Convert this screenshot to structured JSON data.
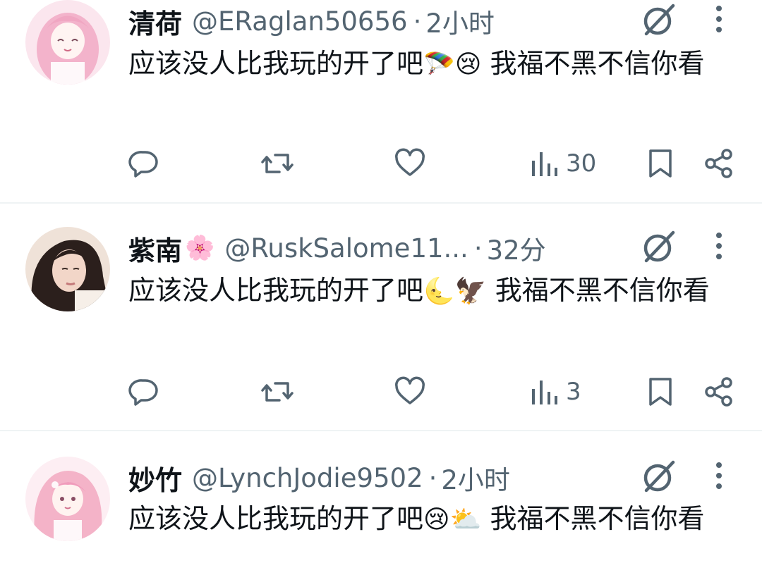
{
  "tweets": [
    {
      "name": "清荷",
      "name_emoji": "",
      "handle": "@ERaglan50656",
      "separator": "·",
      "time": "2小时",
      "text_before": "应该没人比我玩的开了吧",
      "emoji_1": "🪂",
      "emoji_2": "😢",
      "text_after": " 我福不黑不信你看",
      "views": "30",
      "avatar_colors": [
        "#f8d7e6",
        "#f2a9c7",
        "#fff1f6"
      ]
    },
    {
      "name": "紫南",
      "name_emoji": "🌸",
      "handle": "@RuskSalome11...",
      "separator": "·",
      "time": "32分",
      "text_before": "应该没人比我玩的开了吧",
      "emoji_1": "🌜",
      "emoji_2": "🦅",
      "text_after": " 我福不黑不信你看",
      "views": "3",
      "avatar_colors": [
        "#3a2a24",
        "#d9b8a8",
        "#f3e6dd"
      ]
    },
    {
      "name": "妙竹",
      "name_emoji": "",
      "handle": "@LynchJodie9502",
      "separator": "·",
      "time": "2小时",
      "text_before": "应该没人比我玩的开了吧",
      "emoji_1": "😢",
      "emoji_2": "⛅",
      "text_after": " 我福不黑不信你看",
      "views": "",
      "avatar_colors": [
        "#fbe0ea",
        "#f4b6cc",
        "#ffffff"
      ]
    }
  ],
  "icons": {
    "reply": "reply-icon",
    "retweet": "retweet-icon",
    "like": "heart-icon",
    "views": "bar-chart-icon",
    "bookmark": "bookmark-icon",
    "share": "share-icon",
    "grok": "grok-icon",
    "more": "more-vertical-icon"
  },
  "colors": {
    "text": "#0f1419",
    "secondary": "#536471",
    "divider": "#eff3f4"
  }
}
